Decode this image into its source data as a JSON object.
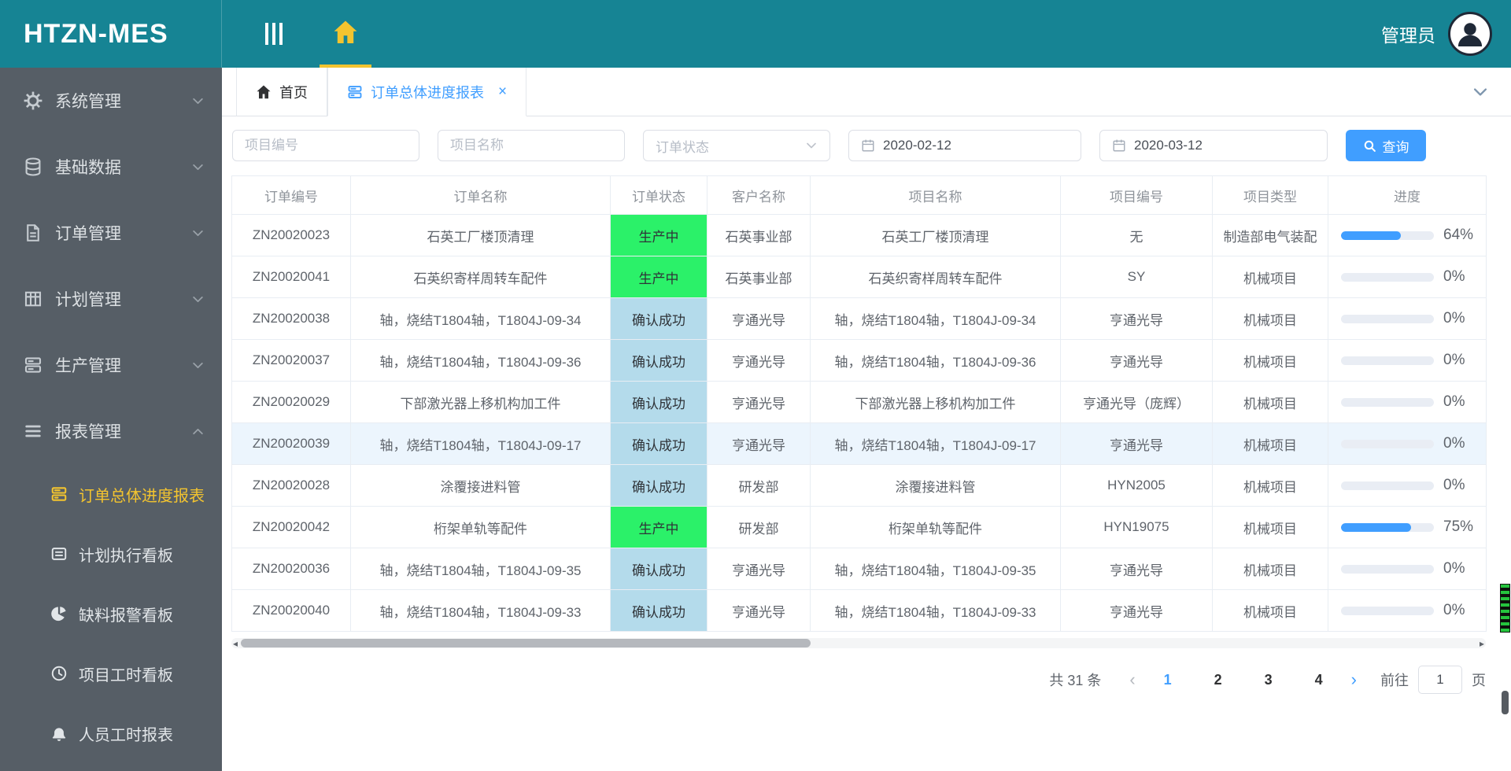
{
  "app": {
    "title": "HTZN-MES",
    "user": "管理员"
  },
  "colors": {
    "header_teal": "#168494",
    "sidebar_bg": "#565e66",
    "accent_gold": "#f3c42f",
    "primary_blue": "#409eff",
    "progress_fill": "#409eff",
    "status_bg": {
      "生产中": "#2bf169",
      "确认成功": "#b4dbeb"
    },
    "highlight_row": "#ecf5fd"
  },
  "sidebar": {
    "items": [
      {
        "label": "系统管理",
        "icon": "gear-icon"
      },
      {
        "label": "基础数据",
        "icon": "database-icon"
      },
      {
        "label": "订单管理",
        "icon": "order-icon"
      },
      {
        "label": "计划管理",
        "icon": "plan-icon"
      },
      {
        "label": "生产管理",
        "icon": "production-icon"
      },
      {
        "label": "报表管理",
        "icon": "report-icon",
        "expanded": true,
        "children": [
          {
            "label": "订单总体进度报表",
            "icon": "order-report-icon",
            "active": true
          },
          {
            "label": "计划执行看板",
            "icon": "plan-board-icon"
          },
          {
            "label": "缺料报警看板",
            "icon": "alert-board-icon"
          },
          {
            "label": "项目工时看板",
            "icon": "project-hours-icon"
          },
          {
            "label": "人员工时报表",
            "icon": "staff-hours-icon"
          }
        ]
      }
    ]
  },
  "tabs": [
    {
      "label": "首页",
      "icon": "home-icon",
      "active": false,
      "closable": false
    },
    {
      "label": "订单总体进度报表",
      "icon": "list-icon",
      "active": true,
      "closable": true,
      "close_glyph": "×"
    }
  ],
  "filters": {
    "project_no_placeholder": "项目编号",
    "project_name_placeholder": "项目名称",
    "order_status_placeholder": "订单状态",
    "date_from": "2020-02-12",
    "date_to": "2020-03-12",
    "search_label": "查询"
  },
  "table": {
    "columns": [
      "订单编号",
      "订单名称",
      "订单状态",
      "客户名称",
      "项目名称",
      "项目编号",
      "项目类型",
      "进度"
    ],
    "rows": [
      {
        "order_no": "ZN20020023",
        "order_name": "石英工厂楼顶清理",
        "status": "生产中",
        "customer": "石英事业部",
        "project_name": "石英工厂楼顶清理",
        "project_no": "无",
        "project_type": "制造部电气装配",
        "progress": 64
      },
      {
        "order_no": "ZN20020041",
        "order_name": "石英织寄样周转车配件",
        "status": "生产中",
        "customer": "石英事业部",
        "project_name": "石英织寄样周转车配件",
        "project_no": "SY",
        "project_type": "机械项目",
        "progress": 0
      },
      {
        "order_no": "ZN20020038",
        "order_name": "轴，烧结T1804轴，T1804J-09-34",
        "status": "确认成功",
        "customer": "亨通光导",
        "project_name": "轴，烧结T1804轴，T1804J-09-34",
        "project_no": "亨通光导",
        "project_type": "机械项目",
        "progress": 0
      },
      {
        "order_no": "ZN20020037",
        "order_name": "轴，烧结T1804轴，T1804J-09-36",
        "status": "确认成功",
        "customer": "亨通光导",
        "project_name": "轴，烧结T1804轴，T1804J-09-36",
        "project_no": "亨通光导",
        "project_type": "机械项目",
        "progress": 0
      },
      {
        "order_no": "ZN20020029",
        "order_name": "下部激光器上移机构加工件",
        "status": "确认成功",
        "customer": "亨通光导",
        "project_name": "下部激光器上移机构加工件",
        "project_no": "亨通光导（庞辉）",
        "project_type": "机械项目",
        "progress": 0
      },
      {
        "order_no": "ZN20020039",
        "order_name": "轴，烧结T1804轴，T1804J-09-17",
        "status": "确认成功",
        "customer": "亨通光导",
        "project_name": "轴，烧结T1804轴，T1804J-09-17",
        "project_no": "亨通光导",
        "project_type": "机械项目",
        "progress": 0,
        "highlighted": true
      },
      {
        "order_no": "ZN20020028",
        "order_name": "涂覆接进料管",
        "status": "确认成功",
        "customer": "研发部",
        "project_name": "涂覆接进料管",
        "project_no": "HYN2005",
        "project_type": "机械项目",
        "progress": 0
      },
      {
        "order_no": "ZN20020042",
        "order_name": "桁架单轨等配件",
        "status": "生产中",
        "customer": "研发部",
        "project_name": "桁架单轨等配件",
        "project_no": "HYN19075",
        "project_type": "机械项目",
        "progress": 75
      },
      {
        "order_no": "ZN20020036",
        "order_name": "轴，烧结T1804轴，T1804J-09-35",
        "status": "确认成功",
        "customer": "亨通光导",
        "project_name": "轴，烧结T1804轴，T1804J-09-35",
        "project_no": "亨通光导",
        "project_type": "机械项目",
        "progress": 0
      },
      {
        "order_no": "ZN20020040",
        "order_name": "轴，烧结T1804轴，T1804J-09-33",
        "status": "确认成功",
        "customer": "亨通光导",
        "project_name": "轴，烧结T1804轴，T1804J-09-33",
        "project_no": "亨通光导",
        "project_type": "机械项目",
        "progress": 0
      }
    ]
  },
  "pagination": {
    "total_label": "共 31 条",
    "prev_glyph": "‹",
    "next_glyph": "›",
    "pages": [
      "1",
      "2",
      "3",
      "4"
    ],
    "active_page": "1",
    "goto_label": "前往",
    "goto_value": "1",
    "unit_label": "页"
  }
}
